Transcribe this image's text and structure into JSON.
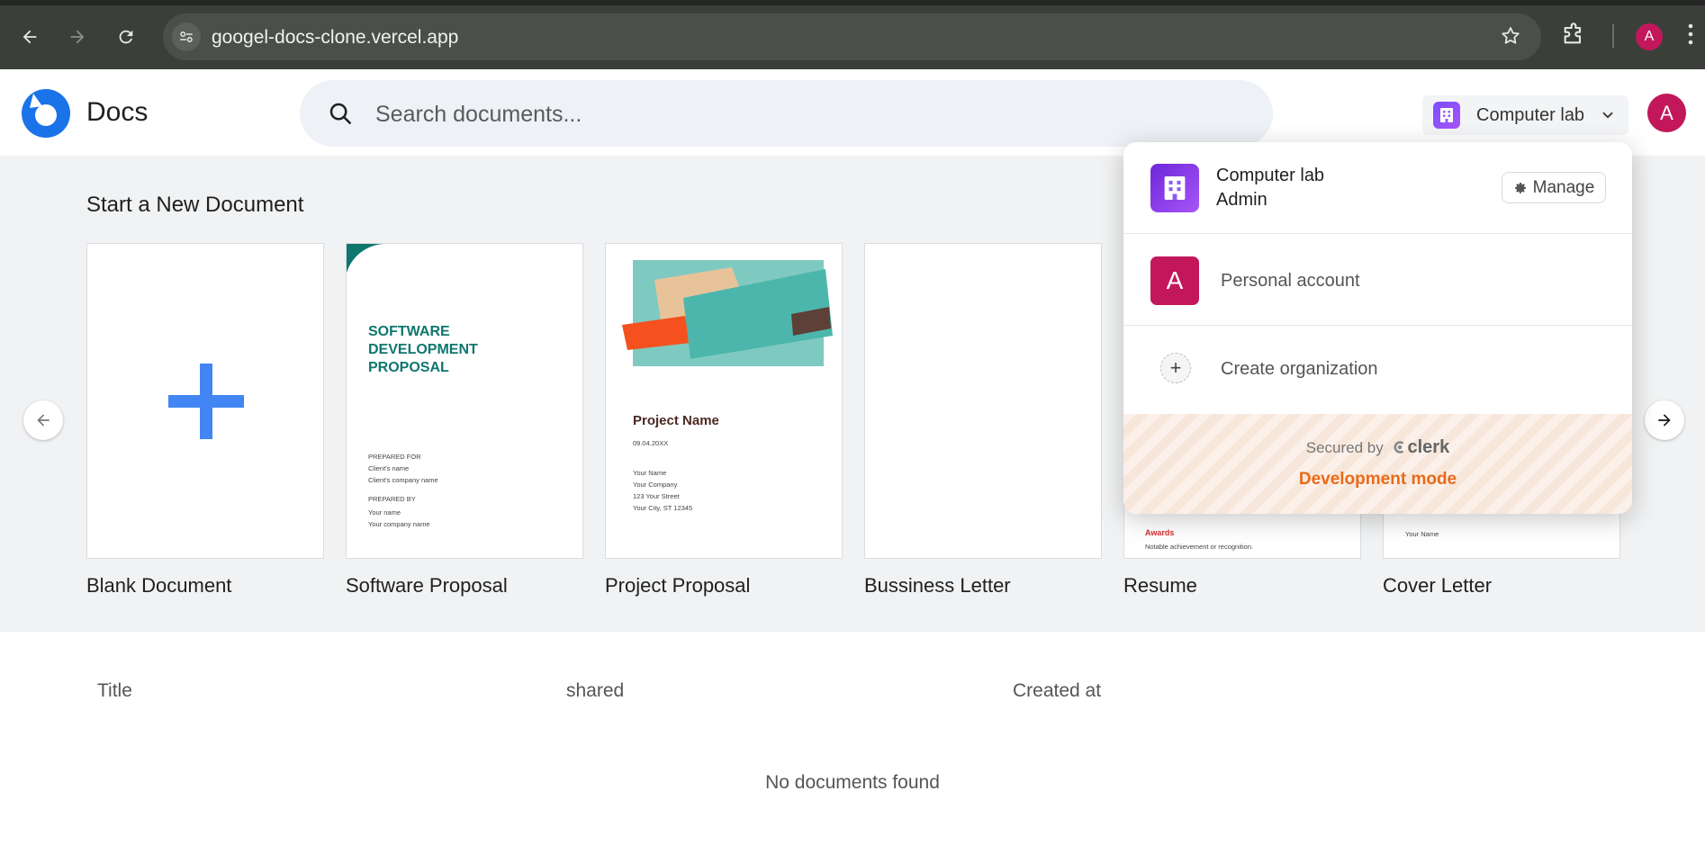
{
  "browser": {
    "url": "googel-docs-clone.vercel.app",
    "avatar_letter": "A"
  },
  "header": {
    "brand": "Docs",
    "search_placeholder": "Search documents...",
    "org_switcher_label": "Computer lab",
    "avatar_letter": "A"
  },
  "templates": {
    "heading": "Start a New Document",
    "items": [
      {
        "label": "Blank Document"
      },
      {
        "label": "Software Proposal",
        "preview_title": "SOFTWARE DEVELOPMENT PROPOSAL",
        "preview_lines": [
          "PREPARED FOR",
          "Client's name",
          "Client's company name",
          "PREPARED BY",
          "Your name",
          "Your company name"
        ]
      },
      {
        "label": "Project Proposal",
        "preview_title": "Project Name",
        "preview_date": "09.04.20XX",
        "preview_lines": [
          "Your Name",
          "Your Company",
          "123 Your Street",
          "Your City, ST 12345"
        ]
      },
      {
        "label": "Bussiness Letter"
      },
      {
        "label": "Resume",
        "preview_title": "Awards",
        "preview_line": "Notable achievement or recognition."
      },
      {
        "label": "Cover Letter",
        "preview_line": "Your Name"
      }
    ]
  },
  "table": {
    "columns": [
      "Title",
      "shared",
      "Created at"
    ],
    "empty_message": "No documents found"
  },
  "org_popover": {
    "active_org": "Computer lab",
    "role": "Admin",
    "manage_label": "Manage",
    "personal_letter": "A",
    "personal_label": "Personal account",
    "create_label": "Create organization",
    "secured_by": "Secured by",
    "clerk": "clerk",
    "dev_mode": "Development mode"
  },
  "colors": {
    "accent_blue": "#1a73e8",
    "avatar": "#c2185b",
    "org": "#7c3aed",
    "dev_mode": "#ea6a1a"
  }
}
